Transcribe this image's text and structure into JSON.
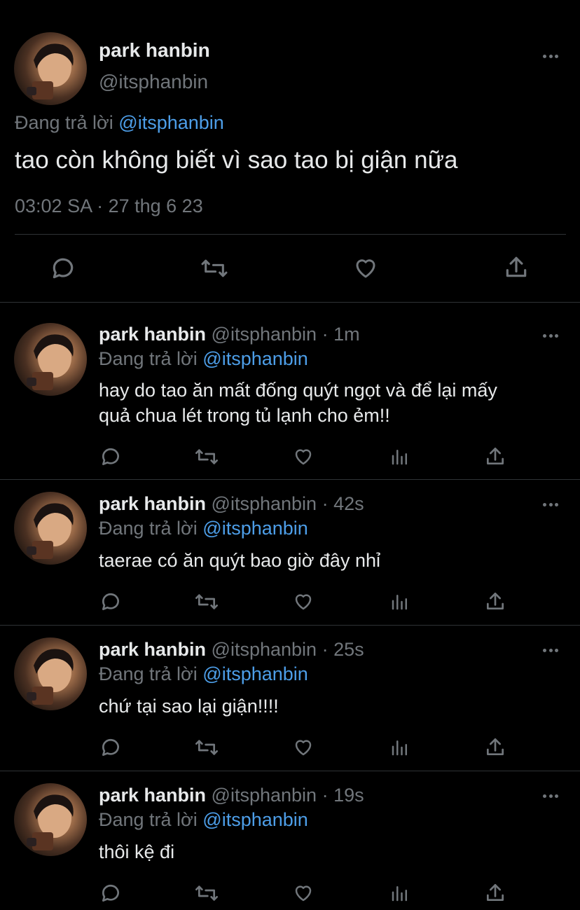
{
  "main_tweet": {
    "author_name": "park hanbin",
    "author_handle": "@itsphanbin",
    "replying_prefix": "Đang trả lời",
    "replying_to": "@itsphanbin",
    "text": "tao còn không biết vì sao tao bị giận nữa",
    "timestamp": "03:02 SA · 27 thg 6 23"
  },
  "replies": [
    {
      "author_name": "park hanbin",
      "author_handle": "@itsphanbin",
      "age": "· 1m",
      "replying_prefix": "Đang trả lời",
      "replying_to": "@itsphanbin",
      "text_line1": "hay do tao ăn mất đống quýt ngọt và để lại mấy",
      "text_line2": "quả chua lét trong tủ lạnh cho ẻm!!"
    },
    {
      "author_name": "park hanbin",
      "author_handle": "@itsphanbin",
      "age": "· 42s",
      "replying_prefix": "Đang trả lời",
      "replying_to": "@itsphanbin",
      "text_line1": "taerae có ăn quýt bao giờ đây nhỉ",
      "text_line2": ""
    },
    {
      "author_name": "park hanbin",
      "author_handle": "@itsphanbin",
      "age": "· 25s",
      "replying_prefix": "Đang trả lời",
      "replying_to": "@itsphanbin",
      "text_line1": "chứ tại sao lại giận!!!!",
      "text_line2": ""
    },
    {
      "author_name": "park hanbin",
      "author_handle": "@itsphanbin",
      "age": "· 19s",
      "replying_prefix": "Đang trả lời",
      "replying_to": "@itsphanbin",
      "text_line1": "thôi kệ đi",
      "text_line2": ""
    }
  ],
  "icons": [
    "more-icon",
    "reply-icon",
    "retweet-icon",
    "like-icon",
    "share-icon",
    "views-icon"
  ],
  "colors": {
    "background": "#000000",
    "text": "#e7e9ea",
    "muted": "#71767b",
    "mention": "#4d9ee8",
    "divider": "#2f3336"
  }
}
